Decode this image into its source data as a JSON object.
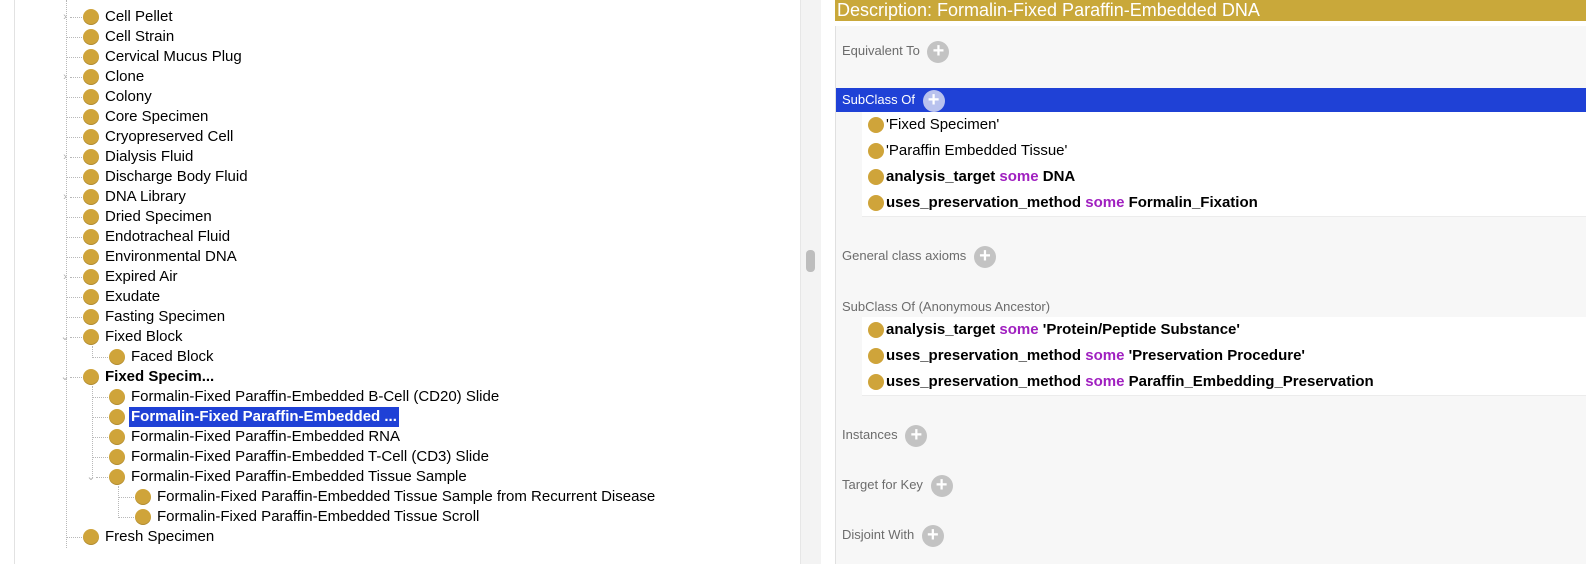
{
  "tree": {
    "items": [
      {
        "label": "Cell Pellet",
        "bold": false,
        "selected": false
      },
      {
        "label": "Cell Strain",
        "bold": false,
        "selected": false
      },
      {
        "label": "Cervical Mucus Plug",
        "bold": false,
        "selected": false
      },
      {
        "label": "Clone",
        "bold": false,
        "selected": false
      },
      {
        "label": "Colony",
        "bold": false,
        "selected": false
      },
      {
        "label": "Core Specimen",
        "bold": false,
        "selected": false
      },
      {
        "label": "Cryopreserved Cell",
        "bold": false,
        "selected": false
      },
      {
        "label": "Dialysis Fluid",
        "bold": false,
        "selected": false
      },
      {
        "label": "Discharge Body Fluid",
        "bold": false,
        "selected": false
      },
      {
        "label": "DNA Library",
        "bold": false,
        "selected": false
      },
      {
        "label": "Dried Specimen",
        "bold": false,
        "selected": false
      },
      {
        "label": "Endotracheal Fluid",
        "bold": false,
        "selected": false
      },
      {
        "label": "Environmental DNA",
        "bold": false,
        "selected": false
      },
      {
        "label": "Expired Air",
        "bold": false,
        "selected": false
      },
      {
        "label": "Exudate",
        "bold": false,
        "selected": false
      },
      {
        "label": "Fasting Specimen",
        "bold": false,
        "selected": false
      },
      {
        "label": "Fixed Block",
        "bold": false,
        "selected": false
      },
      {
        "label": "Faced Block",
        "bold": false,
        "selected": false
      },
      {
        "label": "Fixed Specim...",
        "bold": true,
        "selected": false
      },
      {
        "label": "Formalin-Fixed Paraffin-Embedded B-Cell (CD20) Slide",
        "bold": false,
        "selected": false
      },
      {
        "label": "Formalin-Fixed Paraffin-Embedded ...",
        "bold": true,
        "selected": true
      },
      {
        "label": "Formalin-Fixed Paraffin-Embedded RNA",
        "bold": false,
        "selected": false
      },
      {
        "label": "Formalin-Fixed Paraffin-Embedded T-Cell (CD3) Slide",
        "bold": false,
        "selected": false
      },
      {
        "label": "Formalin-Fixed Paraffin-Embedded Tissue Sample",
        "bold": false,
        "selected": false
      },
      {
        "label": "Formalin-Fixed Paraffin-Embedded Tissue Sample from Recurrent Disease",
        "bold": false,
        "selected": false
      },
      {
        "label": "Formalin-Fixed Paraffin-Embedded Tissue Scroll",
        "bold": false,
        "selected": false
      },
      {
        "label": "Fresh Specimen",
        "bold": false,
        "selected": false
      }
    ]
  },
  "description": {
    "header": "Description: Formalin-Fixed Paraffin-Embedded DNA",
    "equivalent_to": "Equivalent To",
    "subclass_of": "SubClass Of",
    "subclass_items": [
      {
        "prop": "",
        "some": "",
        "filler": "'Fixed Specimen'"
      },
      {
        "prop": "",
        "some": "",
        "filler": "'Paraffin Embedded Tissue'"
      },
      {
        "prop": "analysis_target",
        "some": "some",
        "filler": "DNA"
      },
      {
        "prop": "uses_preservation_method",
        "some": "some",
        "filler": "Formalin_Fixation"
      }
    ],
    "general_class_axioms": "General class axioms",
    "subclass_anon": "SubClass Of (Anonymous Ancestor)",
    "anon_items": [
      {
        "prop": "analysis_target",
        "some": "some",
        "filler": "'Protein/Peptide Substance'"
      },
      {
        "prop": "uses_preservation_method",
        "some": "some",
        "filler": "'Preservation Procedure'"
      },
      {
        "prop": "uses_preservation_method",
        "some": "some",
        "filler": "Paraffin_Embedding_Preservation"
      }
    ],
    "instances": "Instances",
    "target_for_key": "Target for Key",
    "disjoint_with": "Disjoint With"
  },
  "colors": {
    "header_bg": "#c9a83a",
    "selection": "#1f41d6",
    "bullet": "#cfa43a",
    "some_keyword": "#a020c0"
  }
}
